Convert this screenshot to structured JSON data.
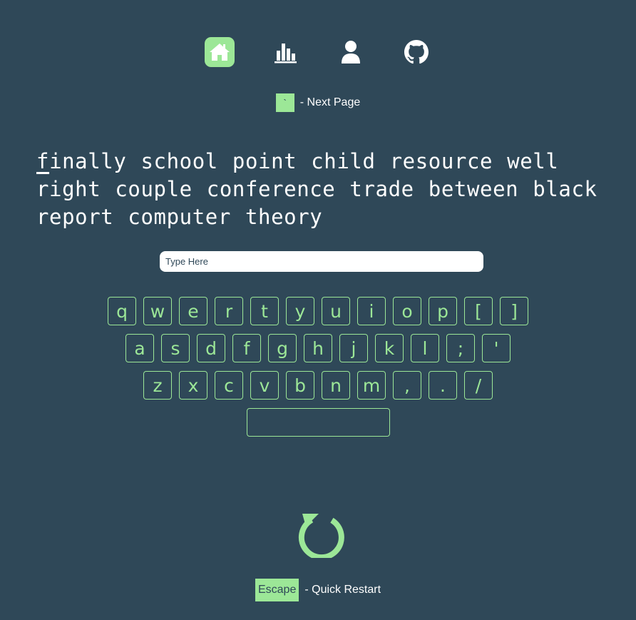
{
  "nav": {
    "items": [
      {
        "icon": "home-icon",
        "active": true
      },
      {
        "icon": "chart-icon",
        "active": false
      },
      {
        "icon": "user-icon",
        "active": false
      },
      {
        "icon": "github-icon",
        "active": false
      }
    ]
  },
  "hint_next": {
    "key": "`",
    "label": "- Next Page"
  },
  "words": {
    "current_letter": "f",
    "rest": "inally school point child resource well right couple conference trade between black report computer theory"
  },
  "input": {
    "placeholder": "Type Here",
    "value": ""
  },
  "keyboard": {
    "row1": [
      "q",
      "w",
      "e",
      "r",
      "t",
      "y",
      "u",
      "i",
      "o",
      "p",
      "[",
      "]"
    ],
    "row2": [
      "a",
      "s",
      "d",
      "f",
      "g",
      "h",
      "j",
      "k",
      "l",
      ";",
      "'"
    ],
    "row3": [
      "z",
      "x",
      "c",
      "v",
      "b",
      "n",
      "m",
      ",",
      ".",
      "/"
    ],
    "space": ""
  },
  "hint_restart": {
    "key": "Escape",
    "label": "- Quick Restart"
  },
  "colors": {
    "background": "#2f4858",
    "accent": "#9ce797",
    "text": "#ffffff"
  }
}
